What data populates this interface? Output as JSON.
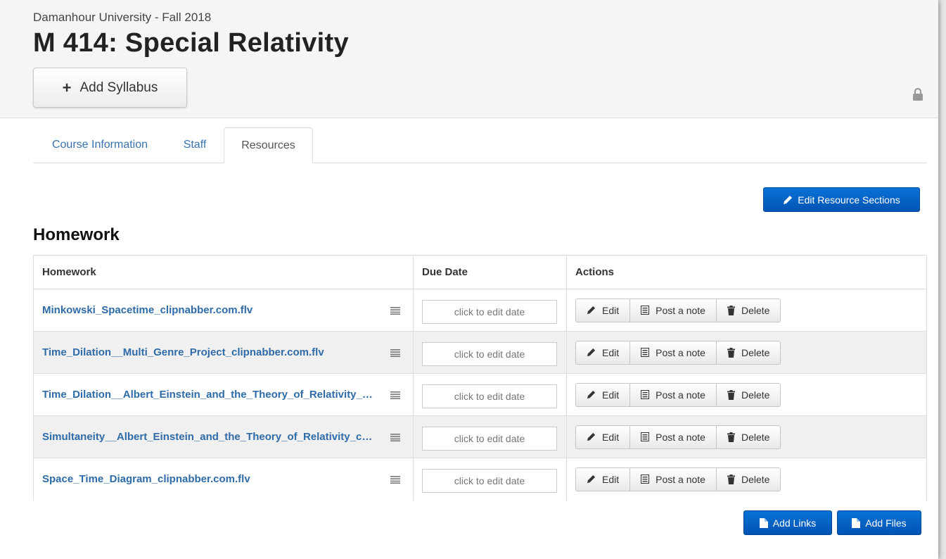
{
  "header": {
    "school": "Damanhour University - Fall 2018",
    "course_title": "M 414: Special Relativity",
    "add_syllabus_label": "Add Syllabus"
  },
  "tabs": [
    {
      "label": "Course Information",
      "active": false
    },
    {
      "label": "Staff",
      "active": false
    },
    {
      "label": "Resources",
      "active": true
    }
  ],
  "edit_sections_label": "Edit Resource Sections",
  "section": {
    "title": "Homework",
    "columns": [
      "Homework",
      "Due Date",
      "Actions"
    ],
    "date_placeholder": "click to edit date",
    "actions": {
      "edit": "Edit",
      "note": "Post a note",
      "delete": "Delete"
    },
    "rows": [
      {
        "name": "Minkowski_Spacetime_clipnabber.com.flv"
      },
      {
        "name": "Time_Dilation__Multi_Genre_Project_clipnabber.com.flv"
      },
      {
        "name": "Time_Dilation__Albert_Einstein_and_the_Theory_of_Relativity_clipnabber.com.flv"
      },
      {
        "name": "Simultaneity__Albert_Einstein_and_the_Theory_of_Relativity_clipnabber.com.flv"
      },
      {
        "name": "Space_Time_Diagram_clipnabber.com.flv"
      }
    ]
  },
  "footer_buttons": {
    "add_links": "Add Links",
    "add_files": "Add Files"
  },
  "colors": {
    "primary": "#0060c4",
    "link": "#2e6ba8",
    "tab_link": "#3a72b0",
    "header_bg": "#f5f5f5"
  },
  "icons": [
    "plus-icon",
    "lock-icon",
    "pencil-icon",
    "drag-handle-icon",
    "note-icon",
    "trash-icon",
    "file-icon"
  ]
}
